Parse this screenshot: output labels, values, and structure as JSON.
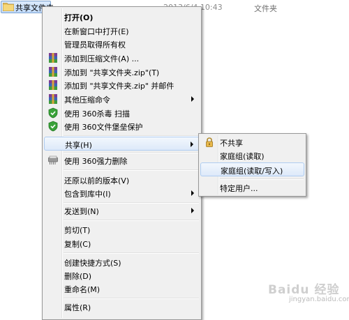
{
  "explorer": {
    "file_name": "共享文件夹",
    "file_date": "2013/6/4 10:43",
    "file_type": "文件夹"
  },
  "context_menu": {
    "items": [
      {
        "label": "打开(O)",
        "icon": "none"
      },
      {
        "label": "在新窗口中打开(E)",
        "icon": "none"
      },
      {
        "label": "管理员取得所有权",
        "icon": "none"
      },
      {
        "label": "添加到压缩文件(A) ...",
        "icon": "winrar-icon"
      },
      {
        "label": "添加到 \"共享文件夹.zip\"(T)",
        "icon": "winrar-icon"
      },
      {
        "label": "添加到 \"共享文件夹.zip\" 并邮件",
        "icon": "winrar-icon"
      },
      {
        "label": "其他压缩命令",
        "icon": "winrar-icon"
      },
      {
        "label": "使用 360杀毒 扫描",
        "icon": "shield-icon"
      },
      {
        "label": "使用 360文件堡垒保护",
        "icon": "shield-icon"
      },
      {
        "label": "共享(H)",
        "icon": "none"
      },
      {
        "label": "使用 360强力删除",
        "icon": "shredder-icon"
      },
      {
        "label": "还原以前的版本(V)",
        "icon": "none"
      },
      {
        "label": "包含到库中(I)",
        "icon": "none"
      },
      {
        "label": "发送到(N)",
        "icon": "none"
      },
      {
        "label": "剪切(T)",
        "icon": "none"
      },
      {
        "label": "复制(C)",
        "icon": "none"
      },
      {
        "label": "创建快捷方式(S)",
        "icon": "none"
      },
      {
        "label": "删除(D)",
        "icon": "none"
      },
      {
        "label": "重命名(M)",
        "icon": "none"
      },
      {
        "label": "属性(R)",
        "icon": "none"
      }
    ]
  },
  "share_submenu": {
    "items": [
      {
        "label": "不共享",
        "icon": "lock-icon"
      },
      {
        "label": "家庭组(读取)",
        "icon": "none"
      },
      {
        "label": "家庭组(读取/写入)",
        "icon": "none"
      },
      {
        "label": "特定用户...",
        "icon": "none"
      }
    ]
  },
  "watermark": {
    "text": "Baidu 经验",
    "sub": "jingyan.baidu.com"
  },
  "colors": {
    "menu_bg": "#f0f0f0",
    "menu_border": "#979797",
    "highlight_border": "#aeccf1",
    "winrar_purple": "#7b3d95",
    "shield_green": "#3aa23a"
  }
}
